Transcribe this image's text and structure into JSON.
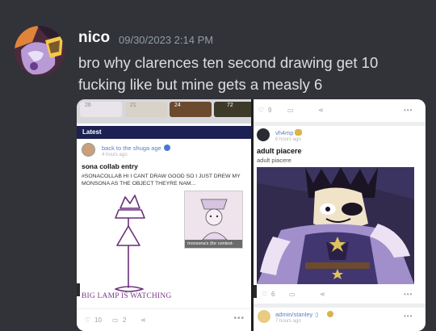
{
  "message": {
    "username": "nico",
    "timestamp": "09/30/2023 2:14 PM",
    "text": "bro why clarences ten second drawing get 10 fucking like but mine gets a measly 6"
  },
  "left_screenshot": {
    "strip_counts": [
      "26",
      "21",
      "24",
      "72"
    ],
    "section_label": "Latest",
    "post": {
      "author": "back to the shuga age",
      "time": "4 hours ago",
      "title": "sona collab entry",
      "body": "#SONACOLLAB HI I CANT DRAW GOOD SO I JUST DREW MY MONSONA AS THE OBJECT THEYRE NAM...",
      "thumb_caption": "monsona's (for contest-Cel...",
      "drawing_caption": "BIG LAMP IS WATCHING",
      "likes": "10",
      "comments": "2"
    }
  },
  "right_screenshot": {
    "top_likes": "9",
    "post": {
      "author": "vh4mp",
      "time": "6 hours ago",
      "title": "adult piacere",
      "subtitle": "adult piacere",
      "likes": "6"
    },
    "next_post": {
      "author": "admin/stanley :)",
      "time": "7 hours ago"
    }
  },
  "colors": {
    "background": "#313338",
    "latest_bar": "#1c2052",
    "link_blue": "#5b7fbf"
  }
}
